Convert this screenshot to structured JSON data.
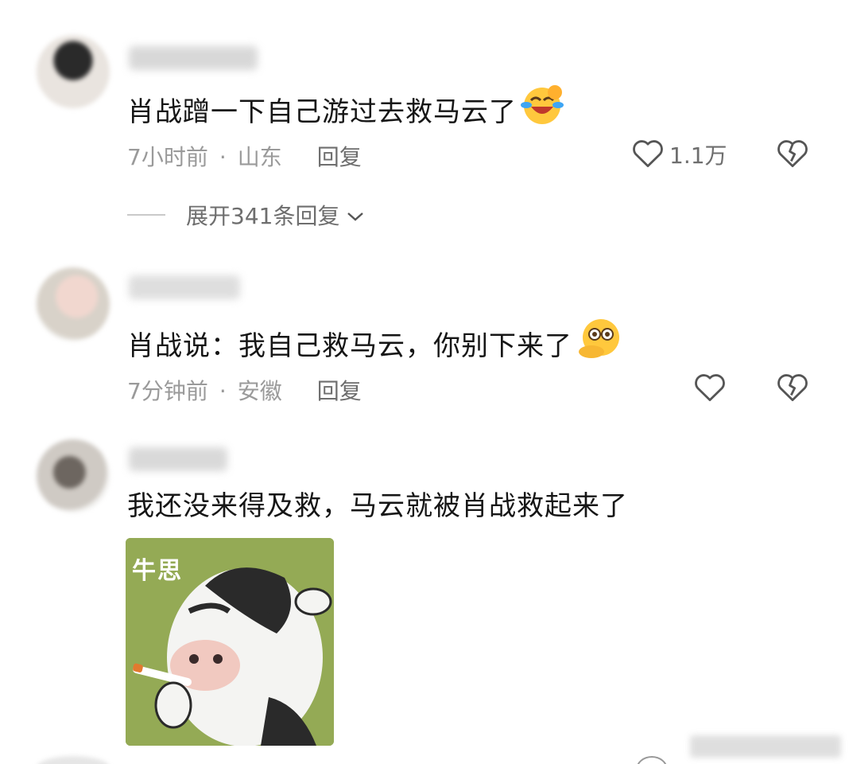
{
  "comments": [
    {
      "text": "肖战蹭一下自己游过去救马云了",
      "emoji": "crying-laughing-emoji",
      "time": "7小时前",
      "location": "山东",
      "reply_label": "回复",
      "like_count": "1.1万",
      "expand_label": "展开341条回复"
    },
    {
      "text": "肖战说：我自己救马云，你别下来了",
      "emoji": "flushed-hand-on-mouth-emoji",
      "time": "7分钟前",
      "location": "安徽",
      "reply_label": "回复",
      "like_count": ""
    },
    {
      "text": "我还没来得及救，马云就被肖战救起来了",
      "sticker_label": "牛思"
    }
  ],
  "separator": "·",
  "colors": {
    "meta_gray": "#9a9a9a",
    "action_gray": "#6e6e6e",
    "sticker_bg": "#8fa64f"
  }
}
